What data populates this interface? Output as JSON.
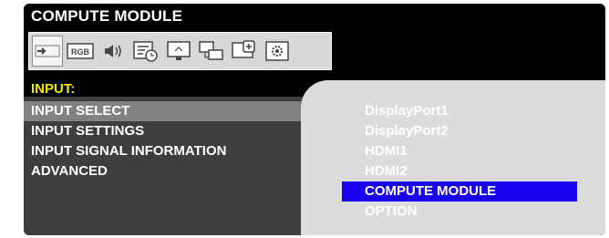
{
  "panel_title": "COMPUTE MODULE",
  "toolbar": {
    "icons": [
      {
        "name": "input-arrow-icon",
        "active": true
      },
      {
        "name": "rgb-icon",
        "label": "RGB"
      },
      {
        "name": "audio-speaker-icon"
      },
      {
        "name": "schedule-icon"
      },
      {
        "name": "monitor-settings-icon"
      },
      {
        "name": "multi-input-icon"
      },
      {
        "name": "add-monitor-icon"
      },
      {
        "name": "gear-icon"
      }
    ]
  },
  "section_header": "INPUT:",
  "menu": {
    "items": [
      {
        "label": "INPUT SELECT",
        "selected": true
      },
      {
        "label": "INPUT SETTINGS"
      },
      {
        "label": "INPUT SIGNAL INFORMATION"
      },
      {
        "label": "ADVANCED"
      }
    ]
  },
  "options": {
    "items": [
      {
        "label": "DisplayPort1"
      },
      {
        "label": "DisplayPort2"
      },
      {
        "label": "HDMI1"
      },
      {
        "label": "HDMI2"
      },
      {
        "label": "COMPUTE MODULE",
        "selected": true
      },
      {
        "label": "OPTION"
      }
    ]
  },
  "colors": {
    "header_text": "#f3e800",
    "selected_option": "#1800ee",
    "selected_menu": "#828282"
  }
}
